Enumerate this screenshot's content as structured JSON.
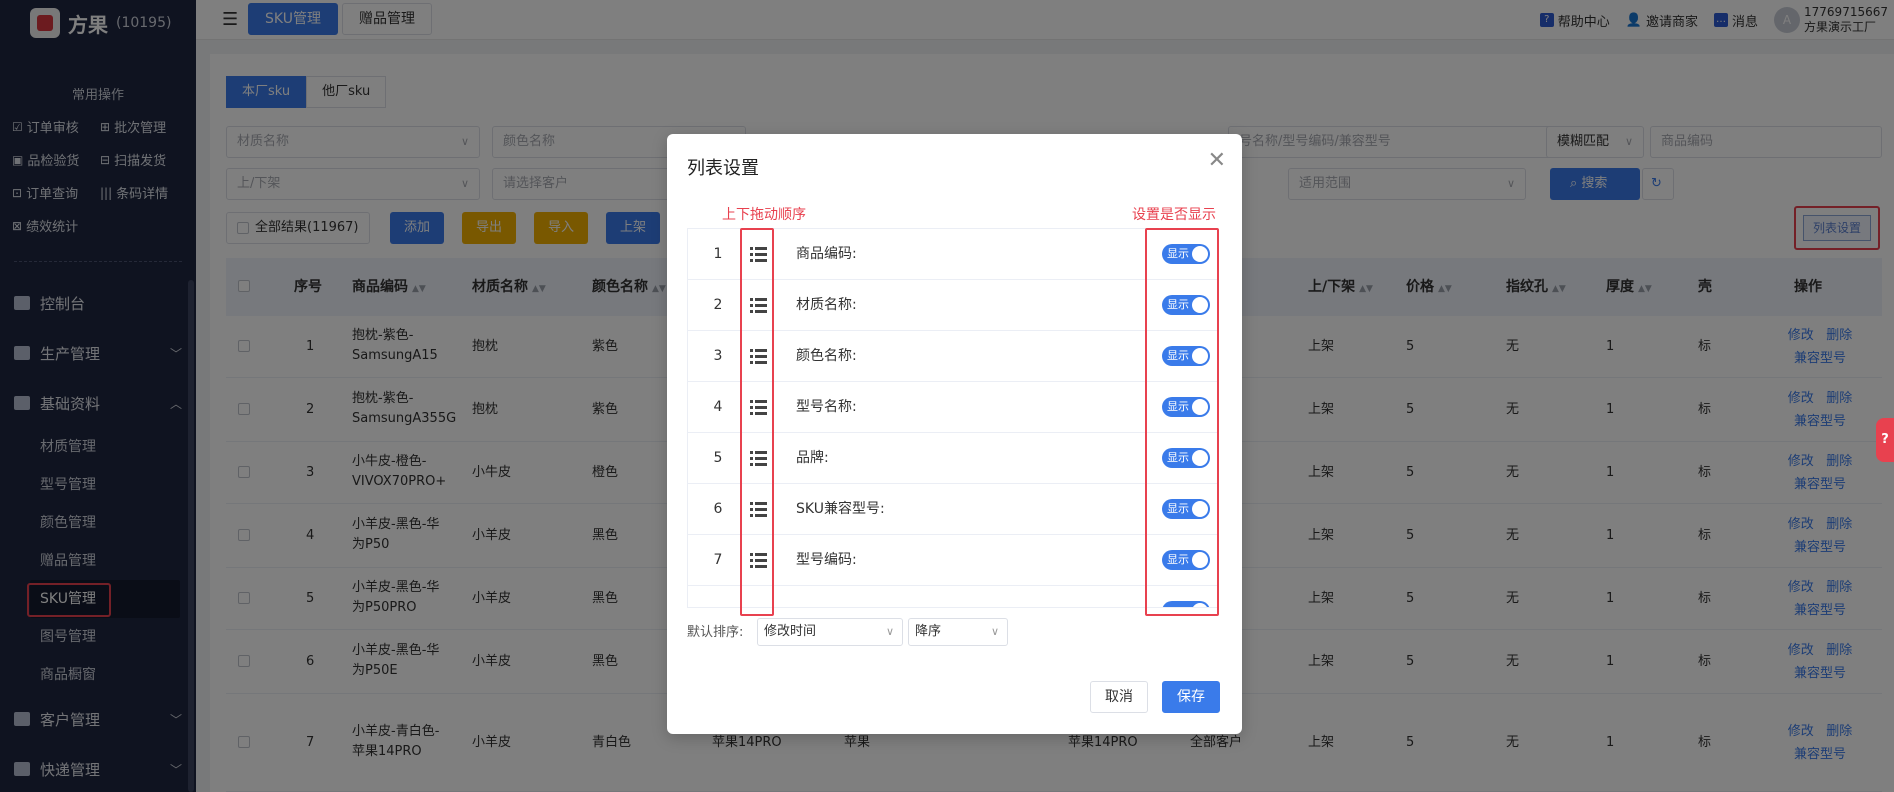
{
  "brand": {
    "name": "方果",
    "code": "(10195)"
  },
  "sidebar": {
    "common_title": "常用操作",
    "quick": [
      "订单审核",
      "批次管理",
      "品检验货",
      "扫描发货",
      "订单查询",
      "条码详情",
      "绩效统计"
    ],
    "groups": [
      {
        "label": "控制台"
      },
      {
        "label": "生产管理"
      },
      {
        "label": "基础资料"
      },
      {
        "label": "客户管理"
      },
      {
        "label": "快递管理"
      }
    ],
    "sub_items": [
      "材质管理",
      "型号管理",
      "颜色管理",
      "赠品管理",
      "SKU管理",
      "图号管理",
      "商品橱窗"
    ]
  },
  "topbar": {
    "tabs": [
      "SKU管理",
      "赠品管理"
    ],
    "help": "帮助中心",
    "invite": "邀请商家",
    "message": "消息",
    "phone": "17769715667",
    "company": "方果演示工厂"
  },
  "filters": {
    "seg": [
      "本厂sku",
      "他厂sku"
    ],
    "material": "材质名称",
    "color": "颜色名称",
    "model_search": "号名称/型号编码/兼容型号",
    "match_mode": "模糊匹配",
    "product_code": "商品编码",
    "shelf": "上/下架",
    "customer": "请选择客户",
    "scope": "适用范围",
    "search": "搜索",
    "total": "全部结果(11967)",
    "add": "添加",
    "export": "导出",
    "import": "导入",
    "on_shelf": "上架",
    "column_setting": "列表设置"
  },
  "table": {
    "headers": [
      "序号",
      "商品编码",
      "材质名称",
      "颜色名称",
      "上/下架",
      "价格",
      "指纹孔",
      "厚度",
      "壳",
      "操作"
    ],
    "rows": [
      {
        "no": "1",
        "code": "抱枕-紫色-SamsungA15",
        "material": "抱枕",
        "color": "紫色",
        "model": "",
        "brand": "",
        "compat": "",
        "customer": "",
        "shelf": "上架",
        "price": "5",
        "finger": "无",
        "thick": "1",
        "shell": "标"
      },
      {
        "no": "2",
        "code": "抱枕-紫色-SamsungA355G",
        "material": "抱枕",
        "color": "紫色",
        "model": "",
        "brand": "",
        "compat": "",
        "customer": "",
        "shelf": "上架",
        "price": "5",
        "finger": "无",
        "thick": "1",
        "shell": "标"
      },
      {
        "no": "3",
        "code": "小牛皮-橙色-VIVOX70PRO+",
        "material": "小牛皮",
        "color": "橙色",
        "model": "",
        "brand": "",
        "compat": "",
        "customer": "",
        "shelf": "上架",
        "price": "5",
        "finger": "无",
        "thick": "1",
        "shell": "标"
      },
      {
        "no": "4",
        "code": "小羊皮-黑色-华为P50",
        "material": "小羊皮",
        "color": "黑色",
        "model": "",
        "brand": "",
        "compat": "",
        "customer": "",
        "shelf": "上架",
        "price": "5",
        "finger": "无",
        "thick": "1",
        "shell": "标"
      },
      {
        "no": "5",
        "code": "小羊皮-黑色-华为P50PRO",
        "material": "小羊皮",
        "color": "黑色",
        "model": "",
        "brand": "",
        "compat": "",
        "customer": "",
        "shelf": "上架",
        "price": "5",
        "finger": "无",
        "thick": "1",
        "shell": "标"
      },
      {
        "no": "6",
        "code": "小羊皮-黑色-华为P50E",
        "material": "小羊皮",
        "color": "黑色",
        "model": "",
        "brand": "",
        "compat": "",
        "customer": "",
        "shelf": "上架",
        "price": "5",
        "finger": "无",
        "thick": "1",
        "shell": "标"
      },
      {
        "no": "7",
        "code": "小羊皮-青白色-苹果14PRO",
        "material": "小羊皮",
        "color": "青白色",
        "model": "苹果14PRO",
        "brand": "苹果",
        "compat": "苹果14PRO",
        "customer": "全部客户",
        "shelf": "上架",
        "price": "5",
        "finger": "无",
        "thick": "1",
        "shell": "标"
      }
    ],
    "op_edit": "修改",
    "op_delete": "删除",
    "op_compat": "兼容型号"
  },
  "modal": {
    "title": "列表设置",
    "anno_order": "上下拖动顺序",
    "anno_show": "设置是否显示",
    "items": [
      {
        "no": "1",
        "name": "商品编码:",
        "toggle": "显示"
      },
      {
        "no": "2",
        "name": "材质名称:",
        "toggle": "显示"
      },
      {
        "no": "3",
        "name": "颜色名称:",
        "toggle": "显示"
      },
      {
        "no": "4",
        "name": "型号名称:",
        "toggle": "显示"
      },
      {
        "no": "5",
        "name": "品牌:",
        "toggle": "显示"
      },
      {
        "no": "6",
        "name": "SKU兼容型号:",
        "toggle": "显示"
      },
      {
        "no": "7",
        "name": "型号编码:",
        "toggle": "显示"
      }
    ],
    "sort_label": "默认排序:",
    "sort_field": "修改时间",
    "sort_order": "降序",
    "cancel": "取消",
    "save": "保存"
  }
}
